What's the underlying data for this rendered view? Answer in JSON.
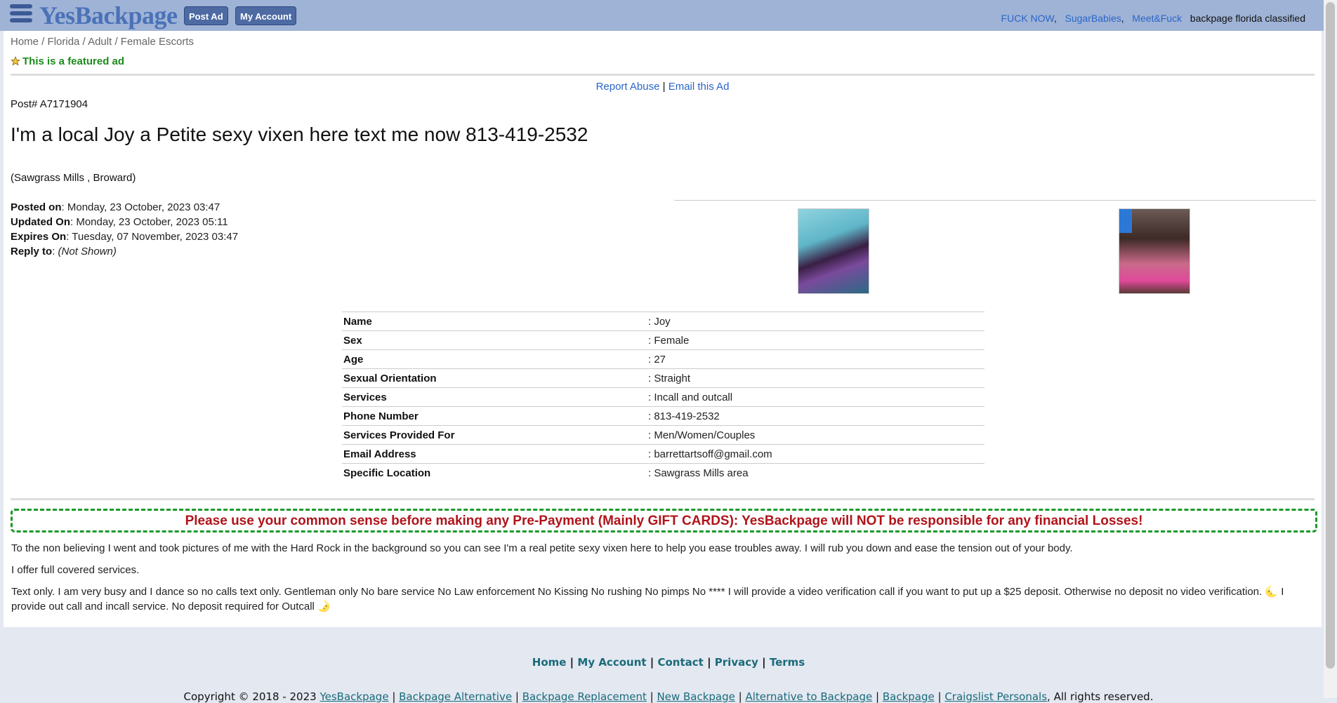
{
  "header": {
    "logo": "YesBackpage",
    "post_ad": "Post Ad",
    "my_account": "My Account",
    "links": [
      "FUCK NOW",
      "SugarBabies",
      "Meet&Fuck"
    ],
    "tagline": "backpage florida classified"
  },
  "breadcrumb": {
    "home": "Home",
    "state": "Florida",
    "category": "Adult",
    "subcategory": "Female Escorts"
  },
  "featured": "This is a featured ad",
  "actions": {
    "report": "Report Abuse",
    "email": "Email this Ad"
  },
  "ad": {
    "post_id": "Post# A7171904",
    "title": "I'm a local Joy a Petite sexy vixen here text me now 813-419-2532",
    "location": "(Sawgrass Mills , Broward)",
    "posted_label": "Posted on",
    "posted": ": Monday, 23 October, 2023  03:47",
    "updated_label": "Updated On",
    "updated": ": Monday, 23 October, 2023  05:11",
    "expires_label": "Expires On",
    "expires": ": Tuesday, 07 November, 2023  03:47",
    "reply_label": "Reply to",
    "reply": "(Not Shown)"
  },
  "details": [
    {
      "k": "Name",
      "v": ": Joy"
    },
    {
      "k": "Sex",
      "v": ": Female"
    },
    {
      "k": "Age",
      "v": ": 27"
    },
    {
      "k": "Sexual Orientation",
      "v": ": Straight"
    },
    {
      "k": "Services",
      "v": ": Incall and outcall"
    },
    {
      "k": "Phone Number",
      "v": ": 813-419-2532"
    },
    {
      "k": "Services Provided For",
      "v": ": Men/Women/Couples"
    },
    {
      "k": "Email Address",
      "v": ": barrettartsoff@gmail.com"
    },
    {
      "k": "Specific Location",
      "v": ": Sawgrass Mills area"
    }
  ],
  "warning": "Please use your common sense before making any Pre-Payment (Mainly GIFT CARDS): YesBackpage will NOT be responsible for any financial Losses!",
  "description": [
    "To the non believing I went and took pictures of me with the Hard Rock in the background so you can see I'm a real petite sexy vixen here to help you ease troubles away. I will rub you down and ease the tension out of your body.",
    "I offer full covered services.",
    "Text only. I am very busy and I dance so no calls text only. Gentleman only No bare service No Law enforcement No Kissing No rushing No pimps No **** I will provide a video verification call if you want to put up a $25 deposit. Otherwise no deposit no video verification. 🌜 I provide out call and incall service. No deposit required for Outcall 🌛"
  ],
  "footer": {
    "links": [
      "Home",
      "My Account",
      "Contact",
      "Privacy",
      "Terms"
    ],
    "copyright_prefix": "Copyright © 2018 - 2023",
    "copyright_links": [
      "YesBackpage",
      "Backpage Alternative",
      "Backpage Replacement",
      "New Backpage",
      "Alternative to Backpage",
      "Backpage",
      "Craigslist Personals"
    ],
    "copyright_suffix": "All rights reserved."
  }
}
